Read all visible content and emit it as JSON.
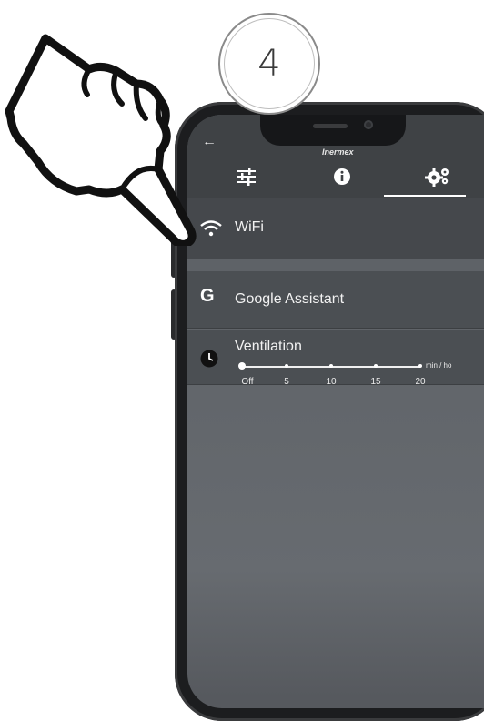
{
  "step": {
    "number": "4"
  },
  "app": {
    "brand": "Inermex",
    "back_icon": "arrow-left-icon",
    "tabs": [
      {
        "icon": "sliders-icon",
        "active": false
      },
      {
        "icon": "info-icon",
        "active": false
      },
      {
        "icon": "gears-icon",
        "active": true
      }
    ]
  },
  "settings": {
    "wifi": {
      "label": "WiFi",
      "icon": "wifi-icon"
    },
    "google": {
      "label": "Google Assistant",
      "icon": "google-icon",
      "icon_glyph": "G"
    },
    "ventilation": {
      "label": "Ventilation",
      "icon": "clock-icon",
      "slider": {
        "ticks": [
          "Off",
          "5",
          "10",
          "15",
          "20"
        ],
        "value": "Off",
        "unit": "min / ho"
      }
    }
  },
  "colors": {
    "header": "#3f4245",
    "screen": "#5f6368",
    "accent": "#ffffff"
  }
}
